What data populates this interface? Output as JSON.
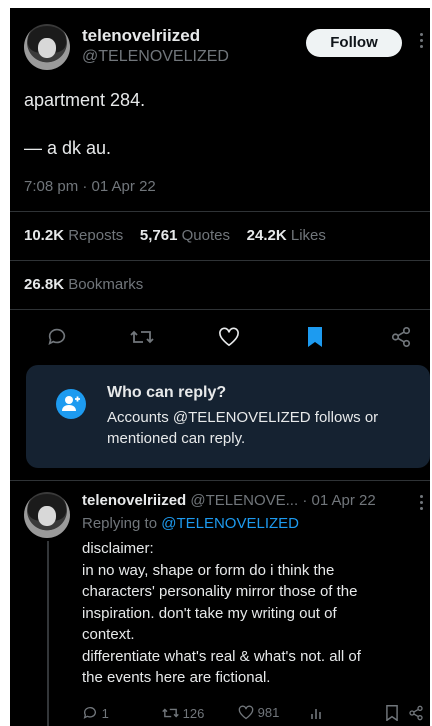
{
  "tweet": {
    "display_name": "telenovelriized",
    "handle": "@TELENOVELIZED",
    "follow_label": "Follow",
    "text_line1": "apartment 284.",
    "text_line2": "— a dk au.",
    "timestamp": "7:08 pm · 01 Apr 22",
    "reposts_count": "10.2K",
    "reposts_label": "Reposts",
    "quotes_count": "5,761",
    "quotes_label": "Quotes",
    "likes_count": "24.2K",
    "likes_label": "Likes",
    "bookmarks_count": "26.8K",
    "bookmarks_label": "Bookmarks"
  },
  "actions": {
    "icons": [
      "reply-icon",
      "repost-icon",
      "like-icon",
      "bookmark-icon",
      "share-icon"
    ],
    "bookmark_active_color": "#1d9bf0"
  },
  "who_can_reply": {
    "title": "Who can reply?",
    "line1": "Accounts @TELENOVELIZED follows or",
    "line2": "mentioned can reply."
  },
  "reply": {
    "display_name": "telenovelriized",
    "handle_truncated": "@TELENOVE...",
    "date": "· 01 Apr 22",
    "replying_to_prefix": "Replying to",
    "replying_to_handle": "@TELENOVELIZED",
    "lines": [
      "disclaimer:",
      "in no way, shape or form do i think the",
      "characters' personality mirror those of the",
      "inspiration. don't take my writing out of",
      "context.",
      "differentiate what's real & what's not. all of",
      "the events here are fictional."
    ],
    "reply_count": "1",
    "repost_count": "126",
    "like_count": "981"
  },
  "colors": {
    "background": "#000000",
    "text": "#e7e9ea",
    "muted": "#71767b",
    "accent": "#1d9bf0",
    "reply_box": "#152231"
  }
}
